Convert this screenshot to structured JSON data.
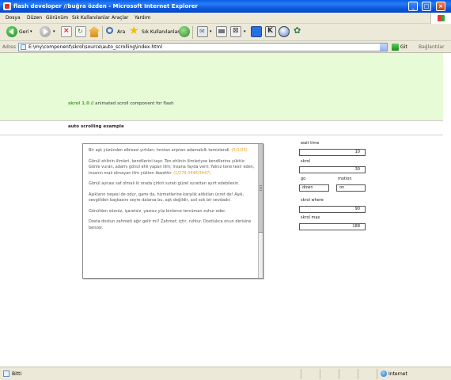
{
  "window": {
    "title": "flash developer //buğra özden - Microsoft Internet Explorer",
    "minimize": "_",
    "maximize": "□",
    "close": "×"
  },
  "menubar": {
    "items": [
      "Dosya",
      "Düzen",
      "Görünüm",
      "Sık Kullanılanlar",
      "Araçlar",
      "Yardım"
    ]
  },
  "toolbar": {
    "back_label": "Geri",
    "search_label": "Ara",
    "favorites_label": "Sık Kullanılanlar"
  },
  "addressbar": {
    "label": "Adres",
    "url": "E:\\my\\component\\skrol\\source\\auto_scrolling\\index.html",
    "go_label": "Git",
    "links_label": "Bağlantılar"
  },
  "page": {
    "tagline_brand": "skrol 1.0",
    "tagline_rest": " // animated scroll component for flash",
    "section_title": "auto scrolling example",
    "paragraphs": [
      {
        "text": "Bir aşk yüzünden elbisesi yırtılan; hırstan arıptan adamakıllı temizlendi. ",
        "ref": "(5/1/25)"
      },
      {
        "text": "Gönül ehlinin ilimleri, kendilerini taşır. Ten ehlinin ilimleriyse kendilerine yüktür. Gönle vuran, adamı gönül ehli yapan ilim; insana fayda verir. Yalnız tene tesir eden, insanın malı olmayan ilim yükten ibarettir. ",
        "ref": "(1/279,3446/3447)"
      },
      {
        "text": "Gönül aynası saf olmalı ki orada çirkin suratı güzel surattan ayırt edebilesin.",
        "ref": ""
      },
      {
        "text": "Aşıkların neşesi de odur, gamı da, hizmetlerine karşılık aldıkları ücret de! Aşık, sevgiliden başkasını seyre dalarsa bu, aşk değildir, asıl sok bir sevdadır.",
        "ref": ""
      },
      {
        "text": "Gönülden sözsüz, işaretsiz, yazısız yüz binlerce tercüman zuhur eder.",
        "ref": ""
      },
      {
        "text": "Dosta dostun zahmeti ağır gelir mi? Zahmet; içtir, ruhtur. Dostlukca onun derisine benzer.",
        "ref": ""
      }
    ],
    "controls": {
      "wait_time_label": "wait time",
      "wait_time_value": "10",
      "skrol_label": "skrol",
      "skrol_value": "30",
      "go_label": "go",
      "go_value": "down",
      "motion_label": "motion",
      "motion_value": "on",
      "skrol_where_label": "skrol where",
      "skrol_where_value": "90",
      "skrol_max_label": "skrol max",
      "skrol_max_value": "188"
    }
  },
  "statusbar": {
    "status": "Bitti",
    "zone": "Internet"
  },
  "colors": {
    "titlebar": "#0a5ee8",
    "chrome": "#ece9d8",
    "header_band": "#e6fbd6",
    "brand_green": "#4ca43c",
    "ref_orange": "#e0a020"
  }
}
